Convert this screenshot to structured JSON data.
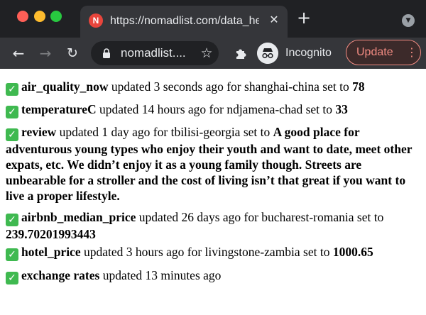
{
  "browser": {
    "tab": {
      "favicon_letter": "N",
      "title": "https://nomadlist.com/data_he",
      "close": "✕"
    },
    "new_tab": "+",
    "address": {
      "url": "nomadlist...."
    },
    "incognito_label": "Incognito",
    "update_label": "Update"
  },
  "entries": [
    {
      "field": "air_quality_now",
      "middle": " updated 3 seconds ago for shanghai-china set to ",
      "value": "78"
    },
    {
      "field": "temperatureC",
      "middle": " updated 14 hours ago for ndjamena-chad set to ",
      "value": "33"
    },
    {
      "field": "review",
      "middle": " updated 1 day ago for tbilisi-georgia set to ",
      "value": "A good place for adventurous young types who enjoy their youth and want to date, meet other expats, etc. We didn’t enjoy it as a young family though. Streets are unbearable for a stroller and the cost of living isn’t that great if you want to live a proper lifestyle."
    },
    {
      "field": "airbnb_median_price",
      "middle": " updated 26 days ago for bucharest-romania set to ",
      "value": "239.70201993443"
    },
    {
      "field": "hotel_price",
      "middle": " updated 3 hours ago for livingstone-zambia set to ",
      "value": "1000.65"
    },
    {
      "field": "exchange rates",
      "middle": " updated 13 minutes ago",
      "value": ""
    }
  ]
}
